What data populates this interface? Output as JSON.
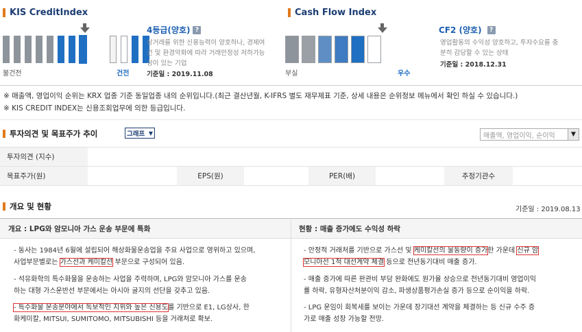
{
  "kis": {
    "title": "KIS CreditIndex",
    "grade": "4등급(양호)",
    "help": "?",
    "description_lines": [
      "상거래를 위한 신용능력이 양호하나, 경제여",
      "건 및 환경악화에 따라 거래안정성 저하가능",
      "성이 있는 기업"
    ],
    "date_label": "기준일 :",
    "date": "2019.11.08",
    "left_label": "불건전",
    "right_label": "건전",
    "total_bars": 8,
    "selected_index": 7
  },
  "cashflow": {
    "title": "Cash Flow Index",
    "grade": "CF2 (양호)",
    "help": "?",
    "description_lines": [
      "영업활동의 수익성 양호하고, 투자수요를 충",
      "분히 감당할 수 있는 상태"
    ],
    "date_label": "기준일 :",
    "date": "2018.12.31",
    "left_label": "부실",
    "right_label": "우수",
    "total_bars": 6,
    "selected_index": 5
  },
  "notes": [
    "※ 매출액, 영업이익 순위는 KRX 업종 기준 동일업종 내의 순위입니다.(최근 결산년월, K-IFRS 별도 재무제표 기준, 상세 내용은 순위정보 메뉴에서 확인 하실 수 있습니다.)",
    "※ KIS CREDIT INDEX는 신용조회업무에 의한 등급입니다."
  ],
  "opinion": {
    "title": "투자의견 및 목표주가 추이",
    "graph_select": "그래프",
    "metric_select": "매출액, 영업이익, 순이익",
    "row1_label": "투자의견 (지수)",
    "row2": [
      "목표주가(원)",
      "EPS(원)",
      "PER(배)",
      "추정기관수"
    ]
  },
  "overview": {
    "title": "개요 및 현황",
    "date_label": "기준일 : 2019.08.13",
    "left_head": "개요 : LPG와 암모니아 가스 운송 부문에 특화",
    "right_head": "현황 : 매출 증가에도 수익성 하락",
    "left_p1_a": "- 동사는 1984년 6월에 설립되어 해상화물운송업을 주요 사업으로 영위하고 있으며,",
    "left_p1_b": "사업부문별로는 ",
    "left_p1_hl1": "가스선과 케미칼선",
    "left_p1_c": " 부문으로 구성되어 있음.",
    "left_p2_a": "- 석유화학의 특수화물을 운송하는 사업을 주력하며, LPG와 암모니아 가스를 운송",
    "left_p2_b": "하는 대형 가스운반선 부문에서는 아시아 굴지의 선단을 갖추고 있음.",
    "left_p3_hl": "- 특수화물 운송분야에서 독보적인 지위와 높은 신용도",
    "left_p3_a": "를 기반으로 E1, LG상사, 한",
    "left_p3_b": "화케미칼, MITSUI, SUMITOMO, MITSUBISHI 등을 거래처로 확보.",
    "right_p1_a": "- 안정적 거래처를 기반으로 가스선 및 ",
    "right_p1_hl1": "케미칼선의 물동량이 증가",
    "right_p1_b": "한 가운데 ",
    "right_p1_hl2a": "신규 암",
    "right_p1_hl2b": "모니아선 1척 대선계약 체결",
    "right_p1_c": " 등으로 전년동기대비 매출 증가.",
    "right_p2_a": "- 매출 증가에 따른 판관비 부담 완화에도 원가율 상승으로 전년동기대비 영업이익",
    "right_p2_b": "률 하락, 유형자산처분이익 감소, 파생상품평가손실 증가 등으로 순이익을 하락.",
    "right_p3_a": "- LPG 운임이 회복세를 보이는 가운데 장기대선 계약을 체결하는 등 신규 수주 증",
    "right_p3_b": "가로 매출 성장 가능할 전망."
  },
  "colors": {
    "accent_blue": "#1f6fc3",
    "bar_grey": "#8e949b",
    "title_navy": "#1c3d73",
    "marker_orange": "#e07a1c",
    "highlight_red": "#e03030"
  }
}
